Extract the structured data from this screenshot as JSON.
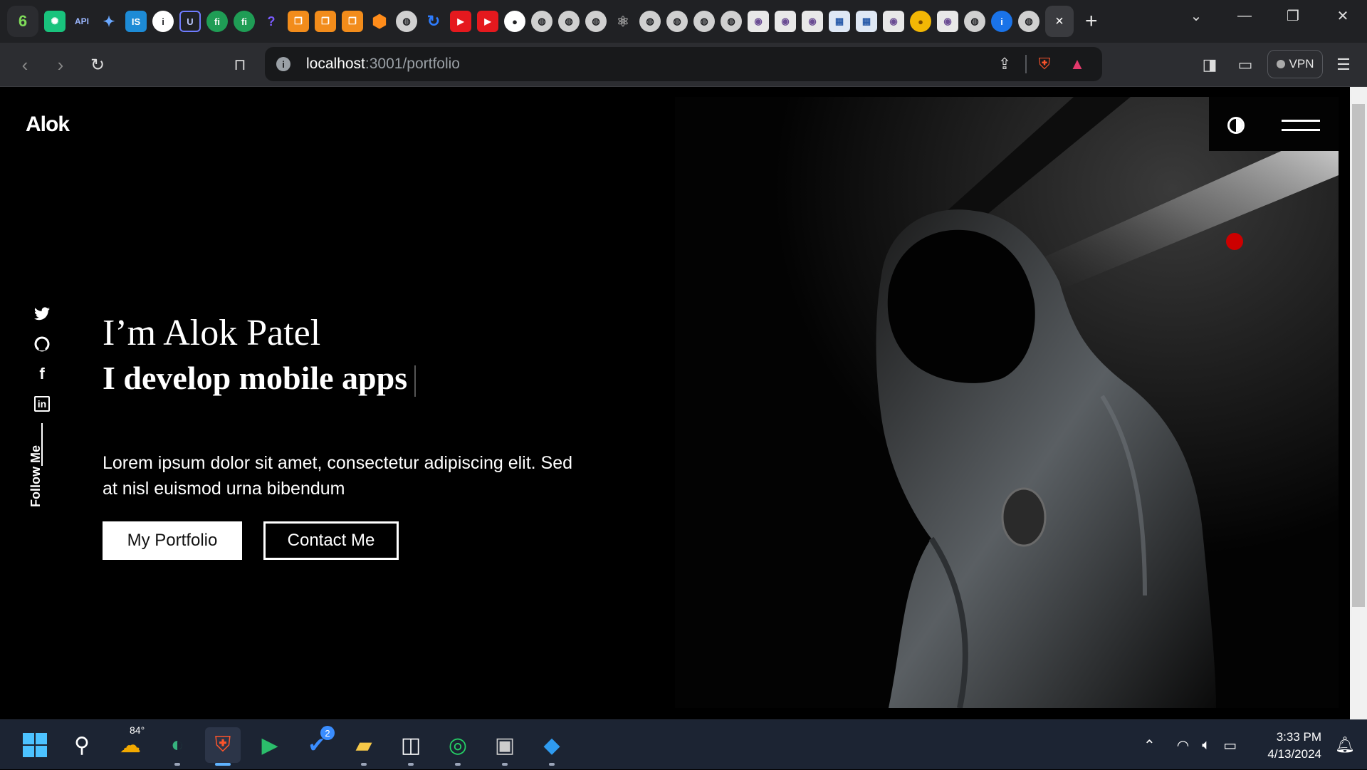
{
  "browser": {
    "tabs": {
      "icons": [
        "app-icon",
        "chatgpt-icon",
        "api-icon",
        "gemini-icon",
        "is-icon",
        "info-icon",
        "u-icon",
        "fi-icon",
        "fi-icon",
        "question-icon",
        "stack-icon",
        "stack-icon",
        "stack-icon",
        "box-icon",
        "globe-icon",
        "loop-icon",
        "youtube-icon",
        "youtube-icon",
        "github-icon",
        "globe-icon",
        "globe-icon",
        "globe-icon",
        "atom-icon",
        "globe-icon",
        "globe-icon",
        "globe-icon",
        "globe-icon",
        "circle-app-icon",
        "circle-app-icon",
        "circle-app-icon",
        "grid-icon",
        "grid-icon",
        "circle-app-icon",
        "coin-icon",
        "circle-app-icon",
        "globe-icon",
        "info-blue-icon",
        "globe-icon"
      ],
      "api_text": "API",
      "is_text": "IS",
      "fi_text": "fi",
      "u_text": "U",
      "q_text": "?",
      "active_close": "×",
      "new_tab": "+"
    },
    "address": {
      "host": "localhost",
      "path": ":3001/portfolio"
    },
    "vpn_label": "VPN"
  },
  "site": {
    "logo": "Alok",
    "greeting": "I’m Alok Patel",
    "role": "I develop mobile apps",
    "description": "Lorem ipsum dolor sit amet, consectetur adipiscing elit. Sed at nisl euismod urna bibendum",
    "buttons": {
      "portfolio": "My Portfolio",
      "contact": "Contact Me"
    },
    "follow_label": "Follow Me",
    "social": [
      "twitter-icon",
      "github-icon",
      "facebook-icon",
      "linkedin-icon"
    ],
    "social_glyphs": {
      "facebook": "f",
      "linkedin": "in"
    }
  },
  "taskbar": {
    "weather_temp": "84°",
    "store_badge": "2",
    "time": "3:33 PM",
    "date": "4/13/2024"
  },
  "colors": {
    "page_bg": "#000000",
    "accent_red": "#cc0000"
  }
}
